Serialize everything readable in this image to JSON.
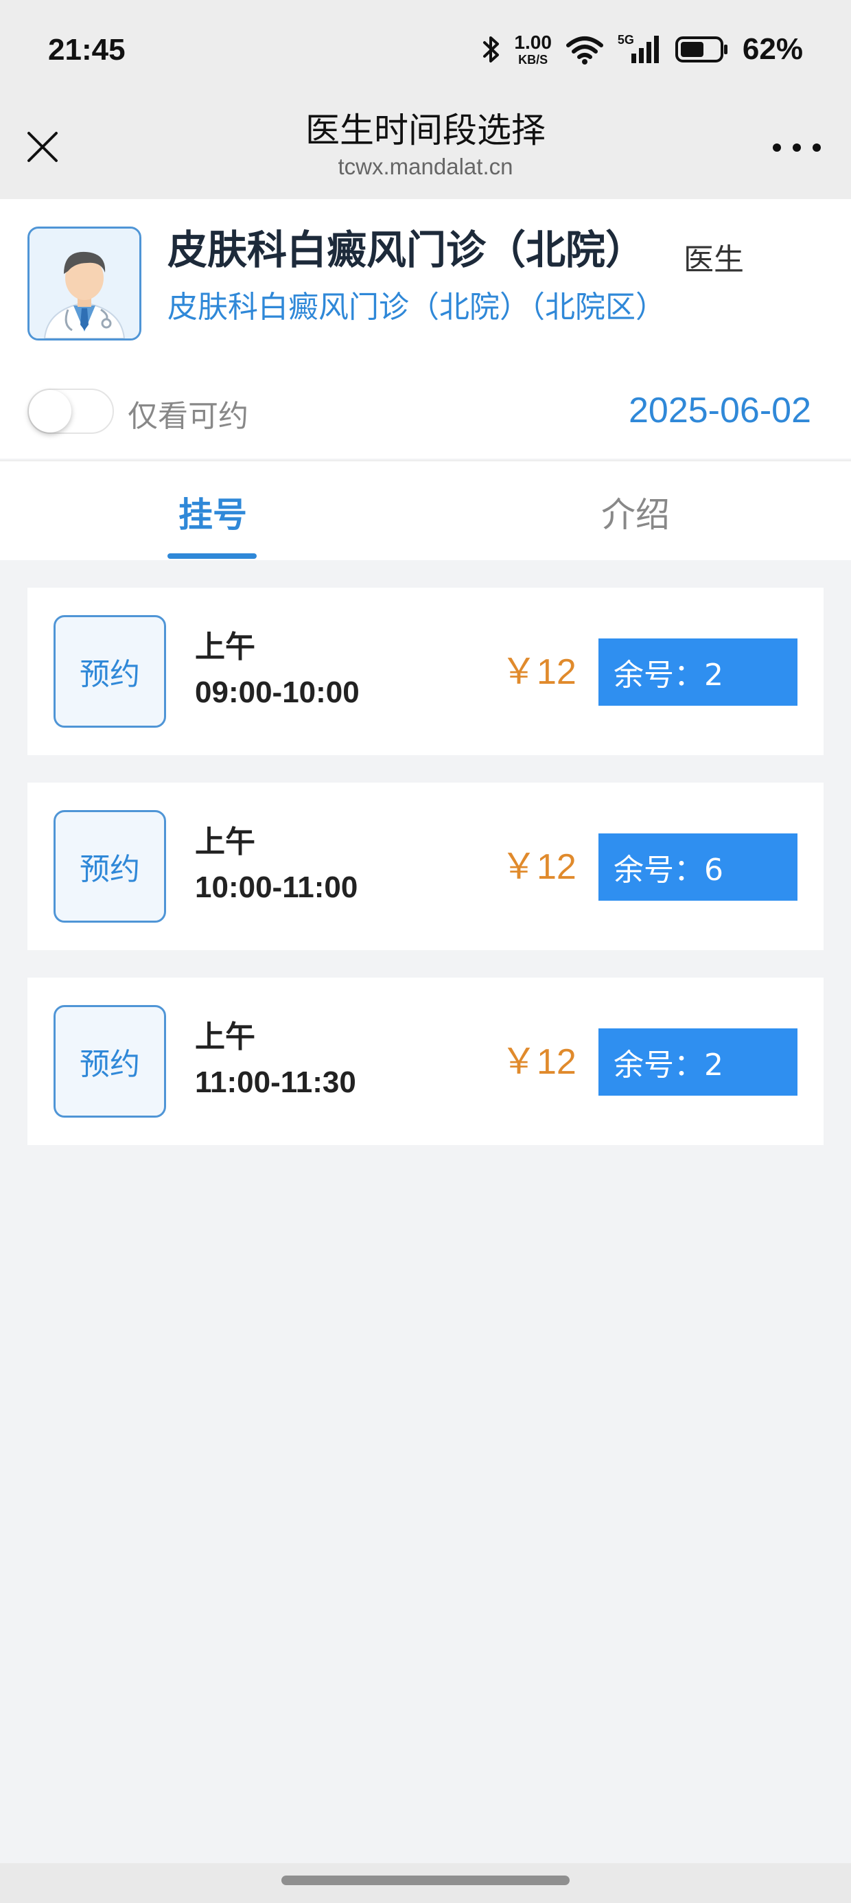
{
  "status_bar": {
    "time": "21:45",
    "net_speed_value": "1.00",
    "net_speed_unit": "KB/S",
    "network_type": "5G",
    "battery_percent": "62%",
    "battery_level": 0.62
  },
  "nav": {
    "title": "医生时间段选择",
    "url": "tcwx.mandalat.cn"
  },
  "doctor": {
    "name": "皮肤科白癜风门诊（北院）",
    "title": "医生",
    "department": "皮肤科白癜风门诊（北院）（北院区）"
  },
  "filter": {
    "only_available_label": "仅看可约",
    "only_available_on": false,
    "date": "2025-06-02"
  },
  "tabs": [
    {
      "label": "挂号",
      "active": true
    },
    {
      "label": "介绍",
      "active": false
    }
  ],
  "slots": [
    {
      "button": "预约",
      "period": "上午",
      "time": "09:00-10:00",
      "price": "￥12",
      "remaining": "余号：2"
    },
    {
      "button": "预约",
      "period": "上午",
      "time": "10:00-11:00",
      "price": "￥12",
      "remaining": "余号：6"
    },
    {
      "button": "预约",
      "period": "上午",
      "time": "11:00-11:30",
      "price": "￥12",
      "remaining": "余号：2"
    }
  ],
  "colors": {
    "accent": "#2f88d8",
    "price": "#e08a2c",
    "remaining_bg": "#2f8ff0",
    "page_bg": "#f2f3f5"
  },
  "icons": [
    "bluetooth-icon",
    "wifi-icon",
    "signal-icon",
    "battery-icon",
    "close-icon",
    "more-icon",
    "doctor-avatar-icon"
  ]
}
